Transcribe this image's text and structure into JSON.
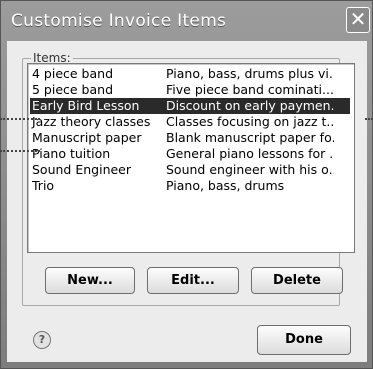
{
  "dialog": {
    "title": "Customise Invoice Items",
    "close_glyph": "✕"
  },
  "group": {
    "label": "Items:"
  },
  "items": [
    {
      "name": "4 piece band",
      "description": "Piano, bass, drums plus vi..."
    },
    {
      "name": "5 piece band",
      "description": "Five piece band cominati..."
    },
    {
      "name": "Early Bird Lesson",
      "description": "Discount on early paymen...",
      "selected": true
    },
    {
      "name": "Jazz theory classes",
      "description": "Classes focusing on jazz t..."
    },
    {
      "name": "Manuscript paper",
      "description": "Blank manuscript paper fo..."
    },
    {
      "name": "Piano tuition",
      "description": "General piano lessons for ..."
    },
    {
      "name": "Sound Engineer",
      "description": "Sound engineer with his o..."
    },
    {
      "name": "Trio",
      "description": "Piano, bass, drums"
    }
  ],
  "buttons": {
    "new": "New...",
    "edit": "Edit...",
    "delete": "Delete",
    "done": "Done"
  },
  "help_glyph": "?"
}
